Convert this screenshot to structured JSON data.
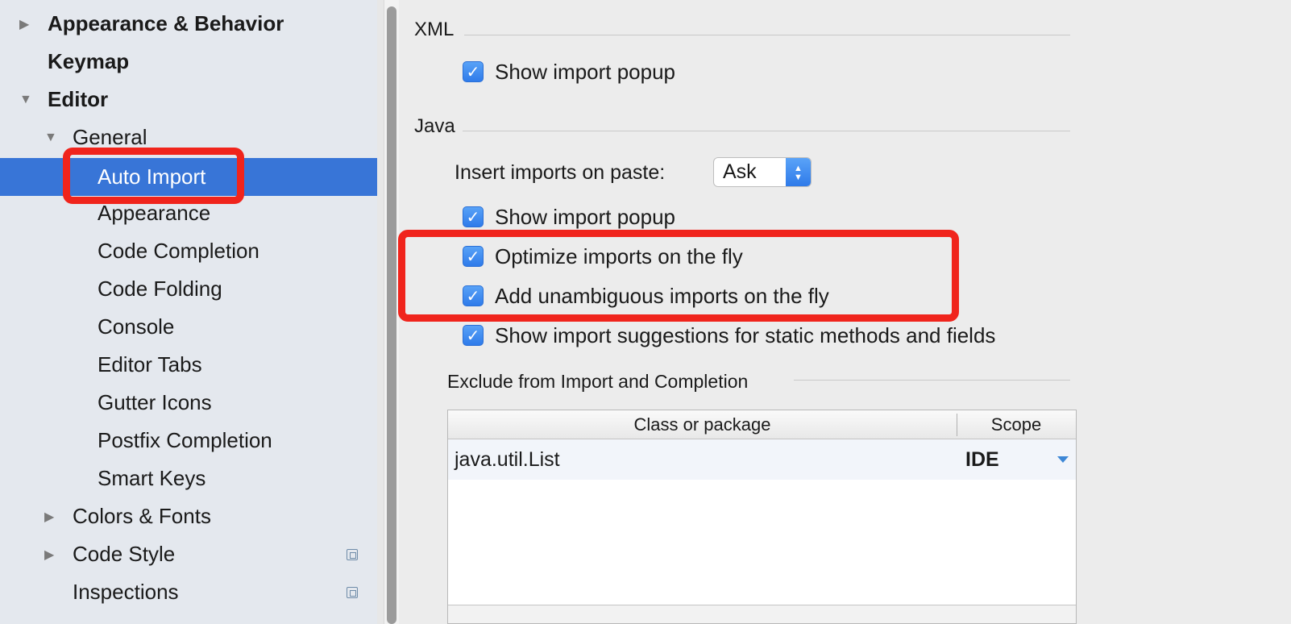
{
  "sidebar": {
    "items": [
      {
        "label": "Appearance & Behavior",
        "arrow": "▶"
      },
      {
        "label": "Keymap"
      },
      {
        "label": "Editor",
        "arrow": "▼"
      },
      {
        "label": "General",
        "arrow": "▼"
      },
      {
        "label": "Auto Import"
      },
      {
        "label": "Appearance"
      },
      {
        "label": "Code Completion"
      },
      {
        "label": "Code Folding"
      },
      {
        "label": "Console"
      },
      {
        "label": "Editor Tabs"
      },
      {
        "label": "Gutter Icons"
      },
      {
        "label": "Postfix Completion"
      },
      {
        "label": "Smart Keys"
      },
      {
        "label": "Colors & Fonts",
        "arrow": "▶"
      },
      {
        "label": "Code Style",
        "arrow": "▶",
        "icon": "project-scope-icon"
      },
      {
        "label": "Inspections",
        "icon": "project-scope-icon"
      }
    ]
  },
  "main": {
    "xml": {
      "title": "XML",
      "show_import_popup": {
        "label": "Show import popup",
        "checked": true
      }
    },
    "java": {
      "title": "Java",
      "insert_imports_label": "Insert imports on paste:",
      "insert_imports_value": "Ask",
      "show_import_popup": {
        "label": "Show import popup",
        "checked": true
      },
      "optimize_imports": {
        "label": "Optimize imports on the fly",
        "checked": true
      },
      "add_unambiguous": {
        "label": "Add unambiguous imports on the fly",
        "checked": true
      },
      "show_suggestions": {
        "label": "Show import suggestions for static methods and fields",
        "checked": true
      }
    },
    "exclude": {
      "title": "Exclude from Import and Completion",
      "columns": [
        "Class or package",
        "Scope"
      ],
      "rows": [
        {
          "class": "java.util.List",
          "scope": "IDE"
        }
      ]
    }
  },
  "icons": {
    "check": "✓",
    "up": "▲",
    "down": "▼"
  },
  "colors": {
    "selection": "#3875d7",
    "highlight": "#f0241c",
    "checkbox": "#2f7bea"
  }
}
